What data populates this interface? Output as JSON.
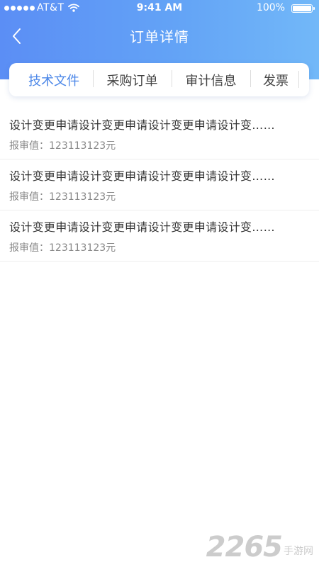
{
  "status_bar": {
    "carrier": "AT&T",
    "time": "9:41 AM",
    "battery": "100%"
  },
  "header": {
    "title": "订单详情",
    "back_icon": "chevron-left-icon"
  },
  "tabs": [
    {
      "label": "技术文件",
      "active": true
    },
    {
      "label": "采购订单",
      "active": false
    },
    {
      "label": "审计信息",
      "active": false
    },
    {
      "label": "发票",
      "active": false
    }
  ],
  "items": [
    {
      "title": "设计变更申请设计变更申请设计变更申请设计变……",
      "meta": "报审值：123113123元"
    },
    {
      "title": "设计变更申请设计变更申请设计变更申请设计变……",
      "meta": "报审值：123113123元"
    },
    {
      "title": "设计变更申请设计变更申请设计变更申请设计变……",
      "meta": "报审值：123113123元"
    }
  ],
  "watermark": {
    "logo": "2265",
    "site": "手游网"
  },
  "colors": {
    "header_start": "#5b8ef5",
    "header_end": "#72b8f8",
    "active_tab": "#4a86e8",
    "text_primary": "#333333",
    "text_secondary": "#888888"
  }
}
